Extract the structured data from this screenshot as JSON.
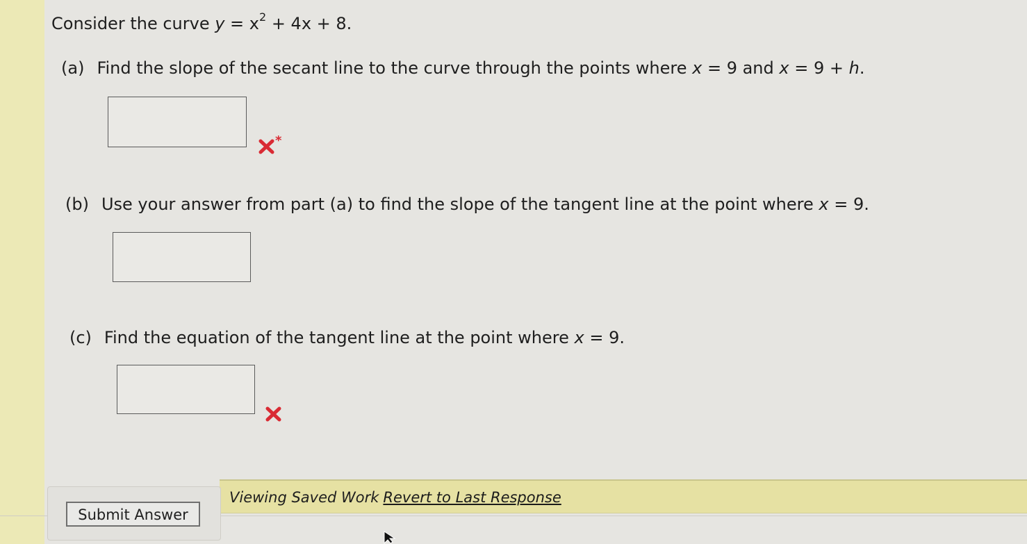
{
  "question": {
    "intro": "Consider the curve",
    "equation_prefix": "y",
    "equation_rest_a": " = x",
    "equation_power": "2",
    "equation_rest_b": " + 4x + 8.",
    "part_a_label": "(a)",
    "part_a_text": "Find the slope of the secant line to the curve through the points where",
    "part_a_x1": "x",
    "part_a_val1": " = 9 and ",
    "part_a_x2": "x",
    "part_a_val2": " = 9 + ",
    "part_a_h": "h",
    "part_a_end": ".",
    "part_b_label": "(b)",
    "part_b_text": "Use your answer from part (a) to find the slope of the tangent line at the point where",
    "part_b_x": "x",
    "part_b_val": " = 9.",
    "part_c_label": "(c)",
    "part_c_text": "Find the equation of the tangent line at the point where",
    "part_c_x": "x",
    "part_c_val": " = 9."
  },
  "answers": {
    "part_a_value": "",
    "part_b_value": "",
    "part_c_value": "",
    "part_a_mark": "incorrect",
    "part_a_note": "*",
    "part_c_mark": "incorrect"
  },
  "status": {
    "viewing": "Viewing Saved Work",
    "revert_link": "Revert to Last Response"
  },
  "actions": {
    "submit_label": "Submit Answer"
  },
  "colors": {
    "incorrect_mark": "#d92b34",
    "status_bar": "#e6e1a3"
  }
}
